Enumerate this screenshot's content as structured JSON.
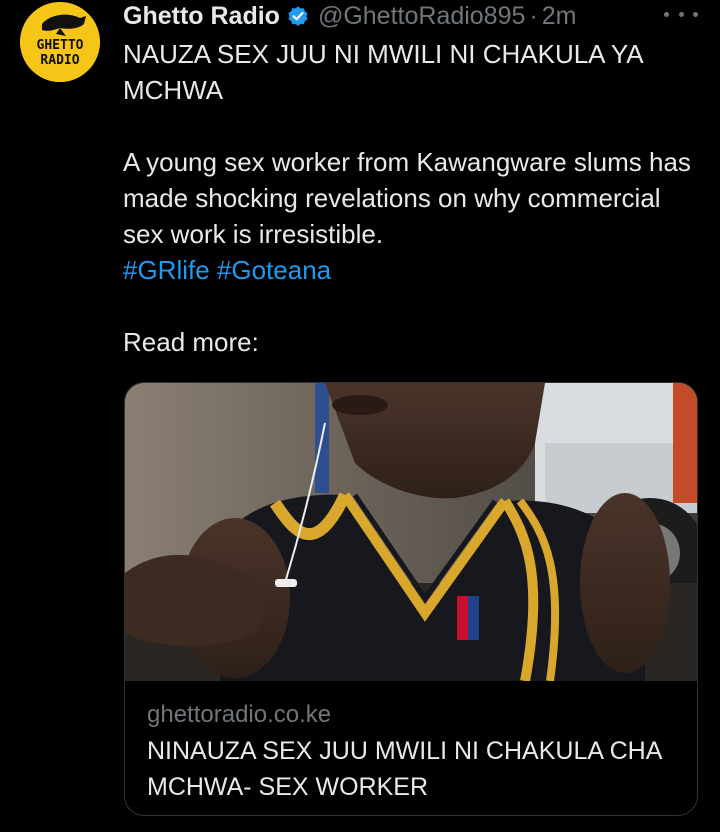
{
  "account": {
    "display_name": "Ghetto Radio",
    "handle": "@GhettoRadio895",
    "separator": "·",
    "timestamp": "2m",
    "avatar_text_line1": "GHETTO",
    "avatar_text_line2": "RADIO",
    "verified": true
  },
  "tweet": {
    "headline": "NAUZA SEX JUU NI MWILI NI CHAKULA YA MCHWA",
    "body": "A young sex worker from Kawangware slums has made shocking revelations on why commercial sex work is irresistible.",
    "hashtags": [
      "#GRlife",
      "#Goteana"
    ],
    "read_more": "Read more:"
  },
  "link_card": {
    "domain": "ghettoradio.co.ke",
    "title": "NINAUZA SEX JUU MWILI NI CHAKULA CHA MCHWA- SEX WORKER",
    "image_alt": "woman wearing black jersey with yellow trim"
  },
  "colors": {
    "background": "#000000",
    "text": "#e7e9ea",
    "muted": "#71767b",
    "link": "#1d9bf0",
    "verified": "#1d9bf0",
    "avatar_bg": "#f5c518"
  },
  "icons": {
    "verified": "verified-badge-icon",
    "more": "more-options-icon"
  }
}
